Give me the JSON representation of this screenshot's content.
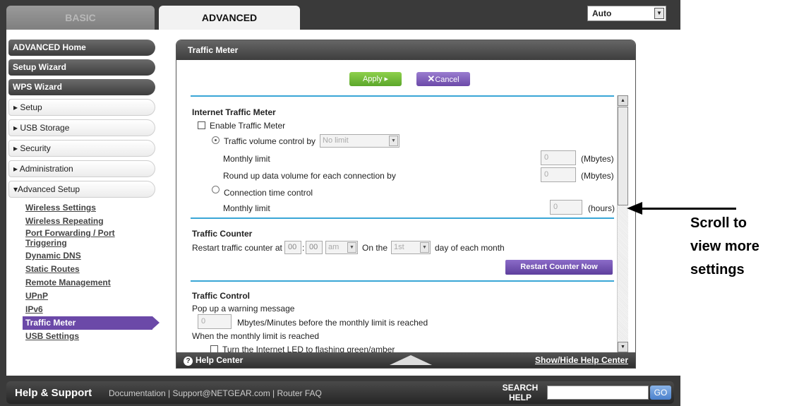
{
  "tabs": {
    "basic": "BASIC",
    "advanced": "ADVANCED"
  },
  "language": {
    "selected": "Auto"
  },
  "nav": {
    "advanced_home": "ADVANCED Home",
    "setup_wizard": "Setup Wizard",
    "wps_wizard": "WPS Wizard",
    "setup": "▸ Setup",
    "usb_storage": "▸ USB Storage",
    "security": "▸ Security",
    "administration": "▸ Administration",
    "advanced_setup": "▾Advanced Setup",
    "sub": {
      "wireless_settings": "Wireless Settings",
      "wireless_repeating": "Wireless Repeating",
      "port_forwarding": "Port Forwarding / Port Triggering",
      "dynamic_dns": "Dynamic DNS",
      "static_routes": "Static Routes",
      "remote_management": "Remote Management",
      "upnp": "UPnP",
      "ipv6": "IPv6",
      "traffic_meter": "Traffic Meter",
      "usb_settings": "USB Settings"
    }
  },
  "panel": {
    "title": "Traffic Meter",
    "apply": "Apply ▸",
    "cancel_x": "✕",
    "cancel": "Cancel"
  },
  "itm": {
    "title": "Internet Traffic Meter",
    "enable": "Enable Traffic Meter",
    "volume_control": "Traffic volume control by",
    "volume_select": "No limit",
    "monthly_limit": "Monthly limit",
    "monthly_value": "0",
    "mbytes1": "(Mbytes)",
    "round_up": "Round up data volume for each connection by",
    "round_value": "0",
    "mbytes2": "(Mbytes)",
    "conn_time": "Connection time control",
    "monthly_limit2": "Monthly limit",
    "hours_value": "0",
    "hours": "(hours)"
  },
  "counter": {
    "title": "Traffic Counter",
    "restart_at": "Restart traffic counter at",
    "hour": "00",
    "colon": ":",
    "minute": "00",
    "ampm": "am",
    "on_the": "On the",
    "day": "1st",
    "day_suffix": "day of each month",
    "restart_now": "Restart Counter Now"
  },
  "control": {
    "title": "Traffic Control",
    "popup": "Pop up a warning message",
    "popup_value": "0",
    "popup_suffix": "Mbytes/Minutes before the monthly limit is reached",
    "when_reached": "When the monthly limit is reached",
    "led": "Turn the Internet LED to flashing green/amber"
  },
  "helpbar": {
    "help_center": "Help Center",
    "show_hide": "Show/Hide Help Center",
    "q": "?"
  },
  "footer": {
    "help_support": "Help & Support",
    "links": "Documentation | Support@NETGEAR.com | Router FAQ",
    "search_help_1": "SEARCH",
    "search_help_2": "HELP",
    "go": "GO"
  },
  "callout": {
    "line1": "Scroll to",
    "line2": "view more",
    "line3": "settings"
  }
}
